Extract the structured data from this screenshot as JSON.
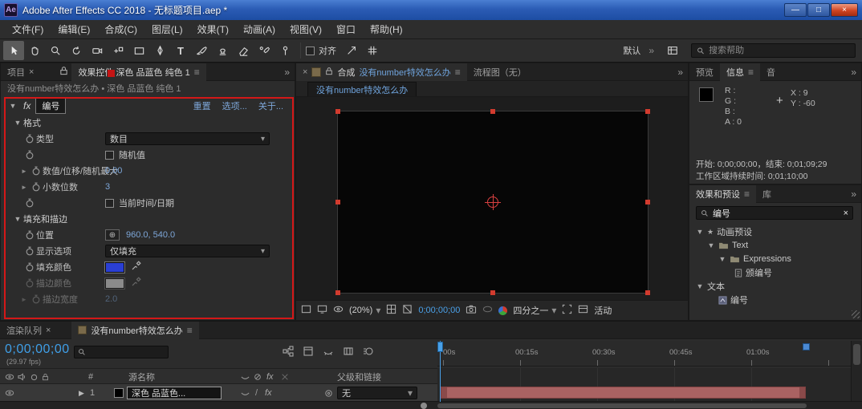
{
  "window": {
    "logo_text": "Ae",
    "title": "Adobe After Effects CC 2018 - 无标题项目.aep *",
    "minimize_glyph": "—",
    "maximize_glyph": "□",
    "close_glyph": "×"
  },
  "icons": {
    "menu": "≡",
    "close": "×",
    "chevron": "▾",
    "twirl_open": "▼",
    "twirl_closed": "►",
    "double_chevron": "»",
    "crosshair": "⊕",
    "plus": "+",
    "star": "★",
    "play": "▶",
    "fx": "fx",
    "slash": "/",
    "dot": "•",
    "type_tool": "T"
  },
  "menu_bar": {
    "items": [
      "文件(F)",
      "编辑(E)",
      "合成(C)",
      "图层(L)",
      "效果(T)",
      "动画(A)",
      "视图(V)",
      "窗口",
      "帮助(H)"
    ]
  },
  "toolbar": {
    "snap_label": "对齐",
    "workspace_label": "默认",
    "search_placeholder": "搜索帮助"
  },
  "effect_controls": {
    "project_tab": "项目",
    "panel_tab": "效果控件 深色 品蓝色 纯色 1",
    "subtitle": "没有number特效怎么办 • 深色 品蓝色 纯色 1",
    "effect_badge": "编号",
    "reset_link": "重置",
    "options_link": "选项...",
    "about_link": "关于...",
    "group_format": "格式",
    "type_label": "类型",
    "type_value": "数目",
    "random_label": "随机值",
    "offset_label": "数值/位移/随机最大",
    "offset_value": "0.00",
    "decimals_label": "小数位数",
    "decimals_value": "3",
    "datetime_label": "当前时间/日期",
    "group_fill": "填充和描边",
    "position_label": "位置",
    "position_value": "960.0, 540.0",
    "display_label": "显示选项",
    "display_value": "仅填充",
    "fill_color_label": "填充颜色",
    "fill_color": "#2a3fd4",
    "stroke_color_label": "描边颜色",
    "stroke_width_label": "描边宽度",
    "stroke_width_value": "2.0"
  },
  "comp_panel": {
    "comp_prefix": "合成",
    "comp_name": "没有number特效怎么办",
    "flowchart_tab": "流程图（无）",
    "viewer_tab": "没有number特效怎么办",
    "zoom": "(20%)",
    "timecode": "0;00;00;00",
    "resolution": "四分之一",
    "camera_label": "活动"
  },
  "info_panel": {
    "preview_tab": "预览",
    "info_tab": "信息",
    "audio_tab": "音",
    "r_label": "R :",
    "g_label": "G :",
    "b_label": "B :",
    "a_label": "A : 0",
    "x_label": "X : 9",
    "y_label": "Y : -60",
    "range_text": "开始: 0;00;00;00，结束: 0;01;09;29",
    "duration_text": "工作区域持续时间: 0;01;10;00"
  },
  "presets_panel": {
    "effects_tab": "效果和预设",
    "libraries_tab": "库",
    "search_value": "编号",
    "tree": [
      {
        "label": "动画预设"
      },
      {
        "label": "Text"
      },
      {
        "label": "Expressions"
      },
      {
        "label": "颁编号"
      },
      {
        "label": "文本"
      },
      {
        "label": "编号"
      }
    ]
  },
  "timeline": {
    "render_queue_tab": "渲染队列",
    "comp_tab": "没有number特效怎么办",
    "timecode": "0;00;00;00",
    "fps": "(29.97 fps)",
    "ruler": [
      "00s",
      "00:15s",
      "00:30s",
      "00:45s",
      "01:00s"
    ],
    "hash_col": "#",
    "source_col": "源名称",
    "parent_col": "父级和链接",
    "layer_number": "1",
    "layer_name": "深色 品蓝色...",
    "parent_value": "无"
  }
}
